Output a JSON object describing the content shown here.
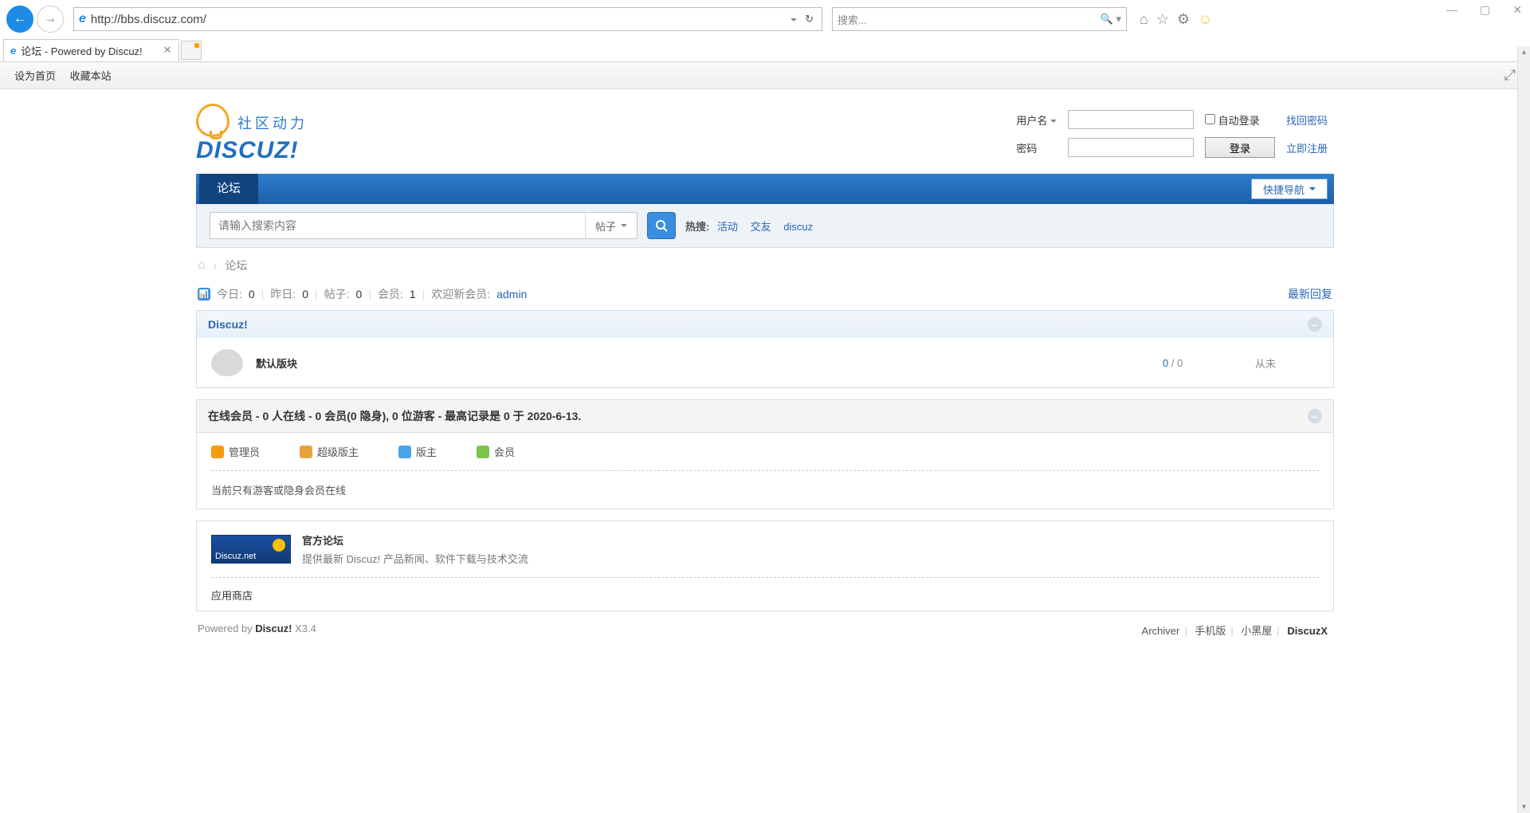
{
  "browser": {
    "url": "http://bbs.discuz.com/",
    "search_placeholder": "搜索...",
    "tab_title": "论坛 - Powered by Discuz!",
    "window_controls": {
      "min": "—",
      "max": "▢",
      "close": "✕"
    }
  },
  "topbar": {
    "set_home": "设为首页",
    "favorite": "收藏本站"
  },
  "logo": {
    "cn": "社区动力",
    "en": "DISCUZ!"
  },
  "login": {
    "user_label": "用户名",
    "pass_label": "密码",
    "auto": "自动登录",
    "btn": "登录",
    "find_pw": "找回密码",
    "register": "立即注册"
  },
  "nav": {
    "forum": "论坛",
    "quick": "快捷导航"
  },
  "search": {
    "placeholder": "请输入搜索内容",
    "type": "帖子",
    "hot_label": "热搜:",
    "hot": [
      "活动",
      "交友",
      "discuz"
    ]
  },
  "breadcrumb": {
    "forum": "论坛"
  },
  "stats": {
    "today_lbl": "今日:",
    "today_v": "0",
    "yest_lbl": "昨日:",
    "yest_v": "0",
    "posts_lbl": "帖子:",
    "posts_v": "0",
    "members_lbl": "会员:",
    "members_v": "1",
    "welcome_lbl": "欢迎新会员:",
    "welcome_v": "admin",
    "latest": "最新回复"
  },
  "category": {
    "title": "Discuz!",
    "board": {
      "name": "默认版块",
      "threads": "0",
      "sep": " / ",
      "posts": "0",
      "last": "从未"
    }
  },
  "online": {
    "header": "在线会员 - 0 人在线 - 0 会员(0 隐身), 0 位游客 - 最高记录是 0 于 2020-6-13.",
    "roles": {
      "admin": "管理员",
      "smod": "超级版主",
      "mod": "版主",
      "mem": "会员"
    },
    "msg": "当前只有游客或隐身会员在线"
  },
  "links": {
    "banner_text": "Discuz.net",
    "title": "官方论坛",
    "desc": "提供最新 Discuz! 产品新闻、软件下载与技术交流",
    "appstore": "应用商店"
  },
  "footer": {
    "powered_pre": "Powered by ",
    "powered_bold": "Discuz!",
    "powered_ver": " X3.4",
    "links": [
      "Archiver",
      "手机版",
      "小黑屋",
      "DiscuzX"
    ]
  }
}
